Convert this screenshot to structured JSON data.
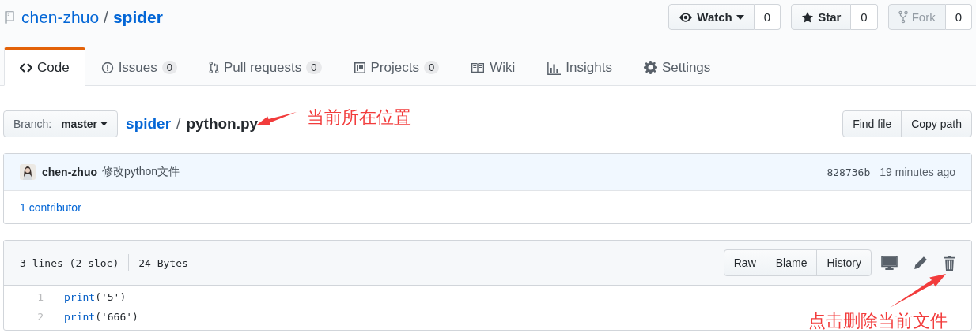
{
  "repo": {
    "owner": "chen-zhuo",
    "separator": "/",
    "name": "spider"
  },
  "actions": [
    {
      "kind": "watch",
      "label": "Watch",
      "count": "0",
      "disabled": false
    },
    {
      "kind": "star",
      "label": "Star",
      "count": "0",
      "disabled": false
    },
    {
      "kind": "fork",
      "label": "Fork",
      "count": "0",
      "disabled": true
    }
  ],
  "tabs": [
    {
      "kind": "code",
      "label": "Code",
      "selected": true
    },
    {
      "kind": "issues",
      "label": "Issues",
      "count": "0",
      "selected": false
    },
    {
      "kind": "pulls",
      "label": "Pull requests",
      "count": "0",
      "selected": false
    },
    {
      "kind": "projects",
      "label": "Projects",
      "count": "0",
      "selected": false
    },
    {
      "kind": "wiki",
      "label": "Wiki",
      "selected": false
    },
    {
      "kind": "insights",
      "label": "Insights",
      "selected": false
    },
    {
      "kind": "settings",
      "label": "Settings",
      "selected": false
    }
  ],
  "branch": {
    "prefix": "Branch:",
    "name": "master"
  },
  "breadcrumb": {
    "folder": "spider",
    "separator": "/",
    "file": "python.py"
  },
  "file_buttons": [
    "Find file",
    "Copy path"
  ],
  "commit": {
    "author": "chen-zhuo",
    "message": "修改python文件",
    "sha": "828736b",
    "time": "19 minutes ago"
  },
  "contributors": "1 contributor",
  "file": {
    "lines": "3 lines (2 sloc)",
    "size": "24 Bytes",
    "buttons": [
      "Raw",
      "Blame",
      "History"
    ],
    "tools": [
      {
        "kind": "desktop"
      },
      {
        "kind": "edit"
      },
      {
        "kind": "delete"
      }
    ],
    "code": [
      {
        "num": "1",
        "tokens": [
          {
            "kind": "builtin",
            "text": "print"
          },
          {
            "kind": "plain",
            "text": "('5')"
          }
        ]
      },
      {
        "num": "2",
        "tokens": [
          {
            "kind": "builtin",
            "text": "print"
          },
          {
            "kind": "plain",
            "text": "('666')"
          }
        ]
      }
    ]
  },
  "annotations": [
    {
      "kind": "path",
      "text": "当前所在位置"
    },
    {
      "kind": "delete",
      "text": "点击删除当前文件"
    }
  ]
}
